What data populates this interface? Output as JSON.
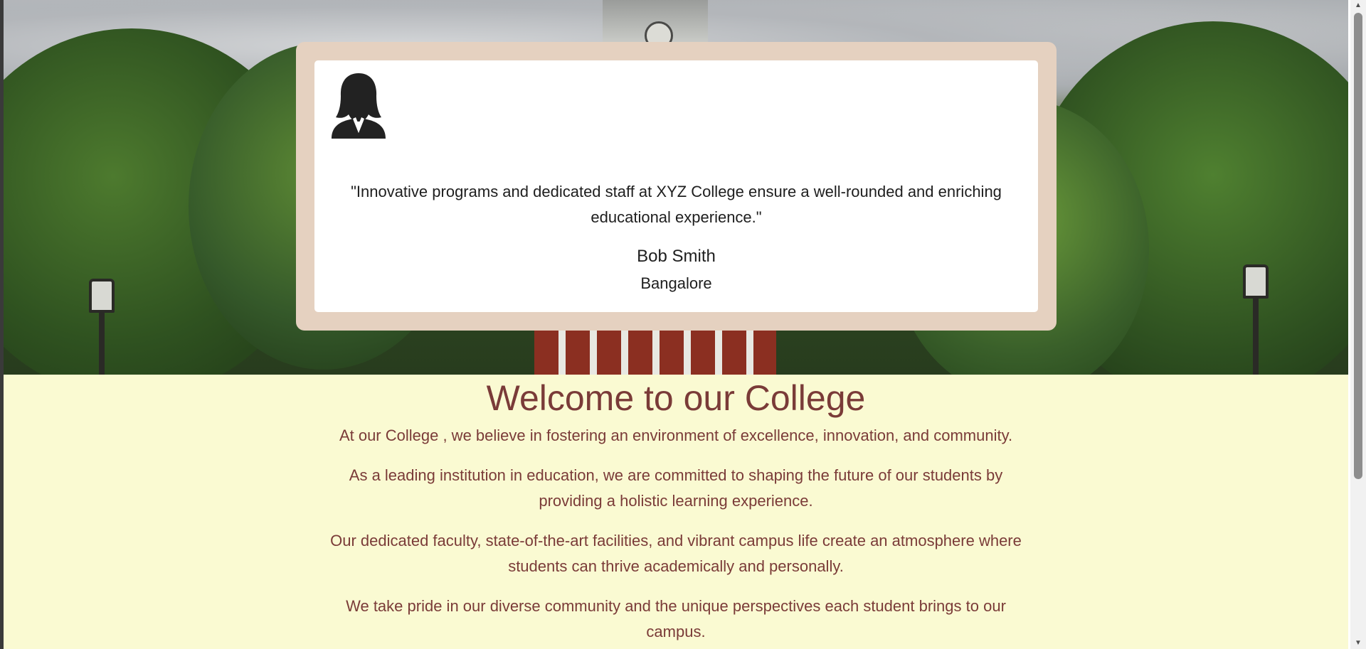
{
  "testimonial": {
    "quote": "\"Innovative programs and dedicated staff at XYZ College ensure a well-rounded and enriching educational experience.\"",
    "author": "Bob Smith",
    "location": "Bangalore",
    "avatar_icon": "female-user-icon"
  },
  "welcome": {
    "title": "Welcome to our College",
    "paragraphs": [
      "At our College , we believe in fostering an environment of excellence, innovation, and community.",
      "As a leading institution in education, we are committed to shaping the future of our students by providing a holistic learning experience.",
      "Our dedicated faculty, state-of-the-art facilities, and vibrant campus life create an atmosphere where students can thrive academically and personally.",
      "We take pride in our diverse community and the unique perspectives each student brings to our campus."
    ]
  },
  "colors": {
    "card_border": "#e5d1c0",
    "welcome_bg": "#fafad2",
    "welcome_text": "#7a3b38"
  }
}
